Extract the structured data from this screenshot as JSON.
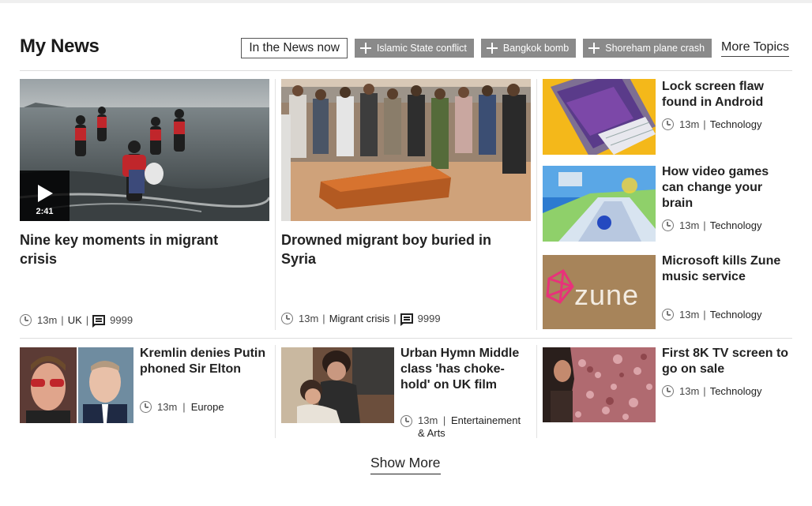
{
  "page": {
    "title": "My News"
  },
  "topics": {
    "current": "In the News now",
    "chips": [
      "Islamic State conflict",
      "Bangkok bomb",
      "Shoreham plane crash"
    ],
    "more_label": "More Topics"
  },
  "stories": {
    "migrant_moments": {
      "headline": "Nine key moments in migrant crisis",
      "time": "13m",
      "section": "UK",
      "comments": "9999",
      "video_duration": "2:41"
    },
    "migrant_boy": {
      "headline": "Drowned migrant boy buried in Syria",
      "time": "13m",
      "section": "Migrant crisis",
      "comments": "9999"
    },
    "android_flaw": {
      "headline": "Lock screen flaw found in Android",
      "time": "13m",
      "section": "Technology"
    },
    "video_games": {
      "headline": "How video games can change your brain",
      "time": "13m",
      "section": "Technology"
    },
    "zune": {
      "headline": "Microsoft kills Zune music service",
      "time": "13m",
      "section": "Technology",
      "logo_text": "zune"
    },
    "kremlin": {
      "headline": "Kremlin denies Putin phoned Sir Elton",
      "time": "13m",
      "section": "Europe"
    },
    "urban_hymn": {
      "headline": "Urban Hymn Middle class 'has choke-hold' on UK film",
      "time": "13m",
      "section": "Entertainement & Arts"
    },
    "tv_8k": {
      "headline": "First 8K TV screen to go on sale",
      "time": "13m",
      "section": "Technology"
    }
  },
  "footer": {
    "show_more": "Show More"
  },
  "icons": {
    "clock": "clock-icon",
    "comment": "comment-icon",
    "play": "play-icon",
    "plus": "plus-icon"
  },
  "colors": {
    "chip_bg": "#8a8a8a",
    "divider": "#dddddd",
    "text": "#222222"
  }
}
